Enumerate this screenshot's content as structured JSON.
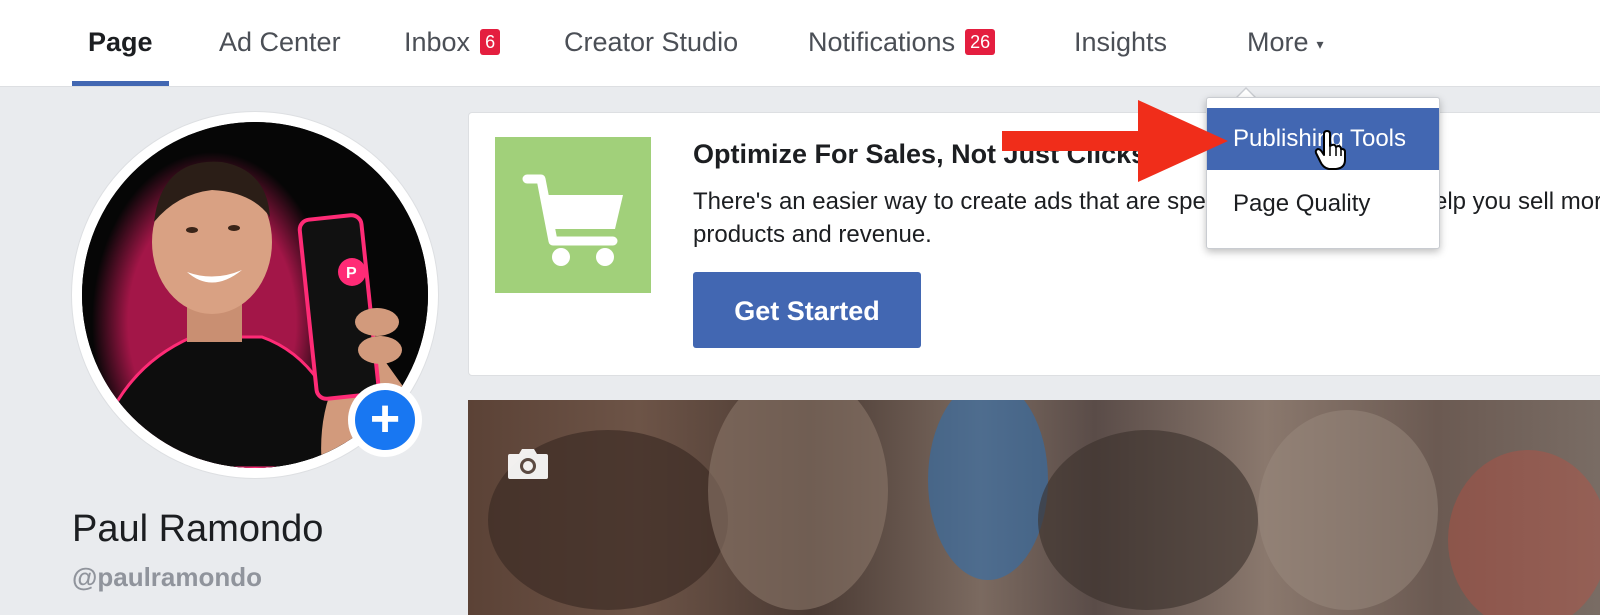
{
  "nav": {
    "tabs": [
      {
        "label": "Page",
        "active": true
      },
      {
        "label": "Ad Center"
      },
      {
        "label": "Inbox",
        "badge": "6"
      },
      {
        "label": "Creator Studio"
      },
      {
        "label": "Notifications",
        "badge": "26"
      },
      {
        "label": "Insights"
      },
      {
        "label": "More",
        "caret": "▾"
      }
    ]
  },
  "dropdown": {
    "items": [
      {
        "label": "Publishing Tools",
        "selected": true
      },
      {
        "label": "Page Quality"
      }
    ]
  },
  "profile": {
    "name": "Paul Ramondo",
    "handle": "@paulramondo",
    "add_button": "+"
  },
  "promo": {
    "title": "Optimize For Sales, Not Just Clicks",
    "body": "There's an easier way to create ads that are specifically designed to help you sell more products and revenue.",
    "button_label": "Get Started",
    "icon": "shopping-cart-icon"
  },
  "cover": {
    "icon": "camera-icon"
  },
  "colors": {
    "accent": "#4267b2",
    "badge": "#e41e3f",
    "promo_icon_bg": "#a1d07a",
    "annotation_arrow": "#f02d1a"
  }
}
